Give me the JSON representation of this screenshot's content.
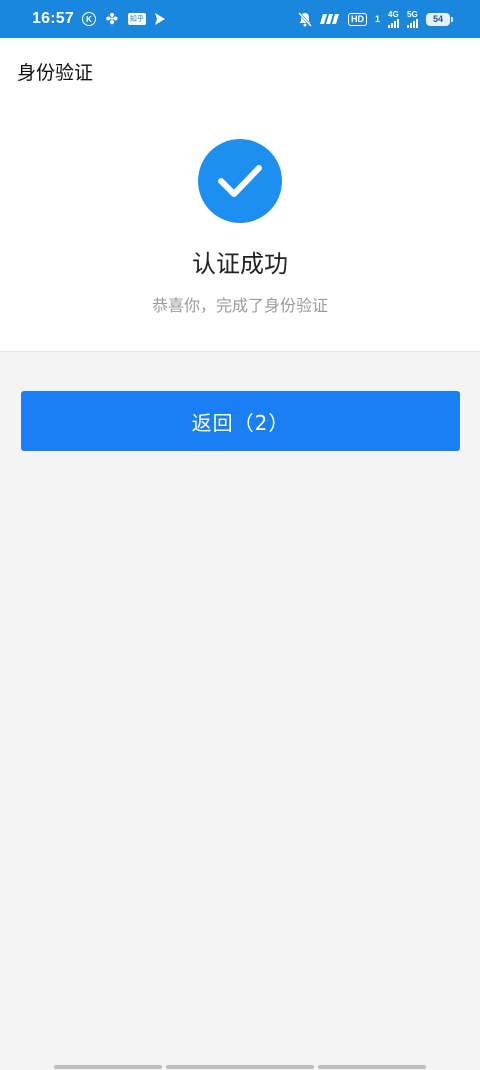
{
  "status_bar": {
    "time": "16:57",
    "hd_label": "HD",
    "hd_sub": "1",
    "sim1_network": "4G",
    "sim2_network": "5G",
    "battery_level": "54",
    "zhihu_label": "知乎",
    "icons": [
      "k-circle-icon",
      "fan-icon",
      "zhihu-icon",
      "send-icon",
      "mute-bell-icon",
      "speed-icon",
      "signal-icon",
      "battery-icon"
    ]
  },
  "header": {
    "title": "身份验证"
  },
  "result": {
    "icon": "check-icon",
    "title": "认证成功",
    "subtitle": "恭喜你，完成了身份验证"
  },
  "actions": {
    "back_label": "返回（2）"
  },
  "colors": {
    "status_bar": "#1a86dc",
    "accent": "#1a7ff5",
    "check_circle": "#1d8ff0",
    "page_bg": "#f4f4f4"
  }
}
